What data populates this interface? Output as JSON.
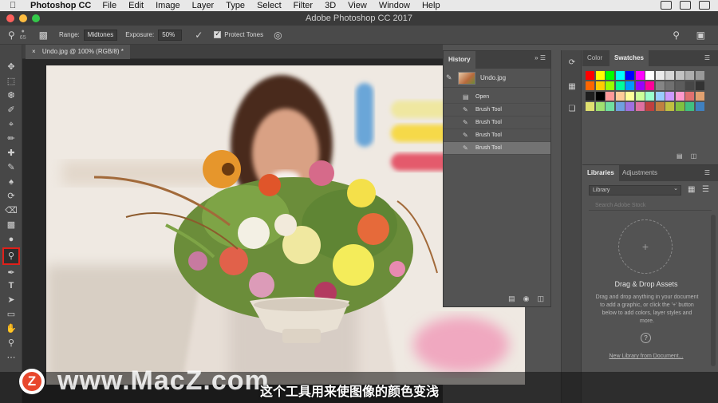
{
  "menubar": {
    "app": "Photoshop CC",
    "items": [
      "File",
      "Edit",
      "Image",
      "Layer",
      "Type",
      "Select",
      "Filter",
      "3D",
      "View",
      "Window",
      "Help"
    ]
  },
  "window": {
    "title": "Adobe Photoshop CC 2017"
  },
  "options": {
    "brush_size": "65",
    "range_label": "Range:",
    "range_value": "Midtones",
    "exposure_label": "Exposure:",
    "exposure_value": "50%",
    "protect_tones_label": "Protect Tones",
    "protect_tones_checked": true
  },
  "document": {
    "tab": "Undo.jpg @ 100% (RGB/8) *"
  },
  "history": {
    "title": "History",
    "snapshot": "Undo.jpg",
    "states": [
      {
        "label": "Open",
        "icon": "document-icon"
      },
      {
        "label": "Brush Tool",
        "icon": "brush-icon"
      },
      {
        "label": "Brush Tool",
        "icon": "brush-icon"
      },
      {
        "label": "Brush Tool",
        "icon": "brush-icon"
      },
      {
        "label": "Brush Tool",
        "icon": "brush-icon",
        "selected": true
      }
    ]
  },
  "color_panel": {
    "tabs": [
      "Color",
      "Swatches"
    ],
    "active_tab": "Swatches",
    "swatches": [
      "#ff0000",
      "#ffff00",
      "#00ff00",
      "#00ffff",
      "#0000ff",
      "#ff00ff",
      "#ffffff",
      "#ebebeb",
      "#d6d6d6",
      "#c2c2c2",
      "#adadad",
      "#999999",
      "#ff6600",
      "#ffcc00",
      "#99ff00",
      "#00ff99",
      "#0099ff",
      "#9900ff",
      "#ff0099",
      "#858585",
      "#707070",
      "#5c5c5c",
      "#474747",
      "#333333",
      "#1f1f1f",
      "#000000",
      "#ff9999",
      "#ffcc99",
      "#ffff99",
      "#ccff99",
      "#99ffcc",
      "#99ccff",
      "#cc99ff",
      "#ff99cc",
      "#e07070",
      "#e0a070",
      "#e0e070",
      "#a0e070",
      "#70e0a0",
      "#70a0e0",
      "#a070e0",
      "#e070a0",
      "#c04040",
      "#c08040",
      "#c0c040",
      "#80c040",
      "#40c080",
      "#4080c0"
    ]
  },
  "libraries": {
    "tabs": [
      "Libraries",
      "Adjustments"
    ],
    "active_tab": "Libraries",
    "selector": "Library",
    "search_placeholder": "Search Adobe Stock",
    "drop_title": "Drag & Drop Assets",
    "drop_text": "Drag and drop anything in your document to add a graphic, or click the '+' button below to add colors, layer styles and more.",
    "new_library_link": "New Library from Document..."
  },
  "overlay": {
    "watermark_text": "www.MacZ.com",
    "logo_letter": "Z",
    "subtitle": "这个工具用来使图像的颜色变浅"
  }
}
